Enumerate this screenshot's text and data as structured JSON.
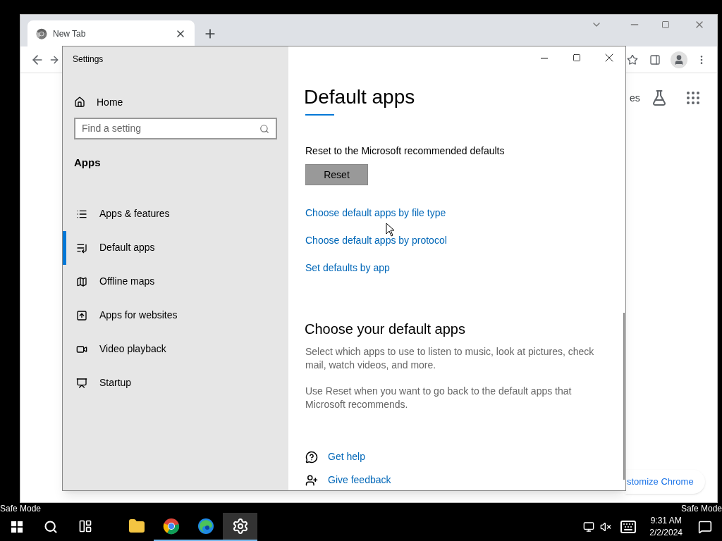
{
  "desktop": {
    "watermarks": [
      "Safe Mode",
      "Safe Mode"
    ]
  },
  "browser": {
    "tabs": [
      {
        "title": "New Tab",
        "selected": true
      }
    ],
    "shortcut_label": "es",
    "customize_button": "stomize Chrome"
  },
  "settings": {
    "title": "Settings",
    "home": "Home",
    "search": {
      "placeholder": "Find a setting"
    },
    "section": "Apps",
    "nav": [
      {
        "label": "Apps & features",
        "selected": false
      },
      {
        "label": "Default apps",
        "selected": true
      },
      {
        "label": "Offline maps",
        "selected": false
      },
      {
        "label": "Apps for websites",
        "selected": false
      },
      {
        "label": "Video playback",
        "selected": false
      },
      {
        "label": "Startup",
        "selected": false
      }
    ],
    "heading": "Default apps",
    "reset_label": "Reset to the Microsoft recommended defaults",
    "reset_button": "Reset",
    "links": [
      "Choose default apps by file type",
      "Choose default apps by protocol",
      "Set defaults by app"
    ],
    "section_heading": "Choose your default apps",
    "paragraphs": [
      "Select which apps to use to listen to music, look at pictures, check mail, watch videos, and more.",
      "Use Reset when you want to go back to the default apps that Microsoft recommends."
    ],
    "help": [
      "Get help",
      "Give feedback"
    ]
  },
  "taskbar": {
    "apps": [
      {
        "running": false,
        "selected": false
      },
      {
        "running": false,
        "selected": false
      },
      {
        "running": true,
        "selected": false
      },
      {
        "running": true,
        "selected": false
      },
      {
        "running": true,
        "selected": true
      }
    ],
    "time": "9:31 AM",
    "date": "2/2/2024"
  }
}
